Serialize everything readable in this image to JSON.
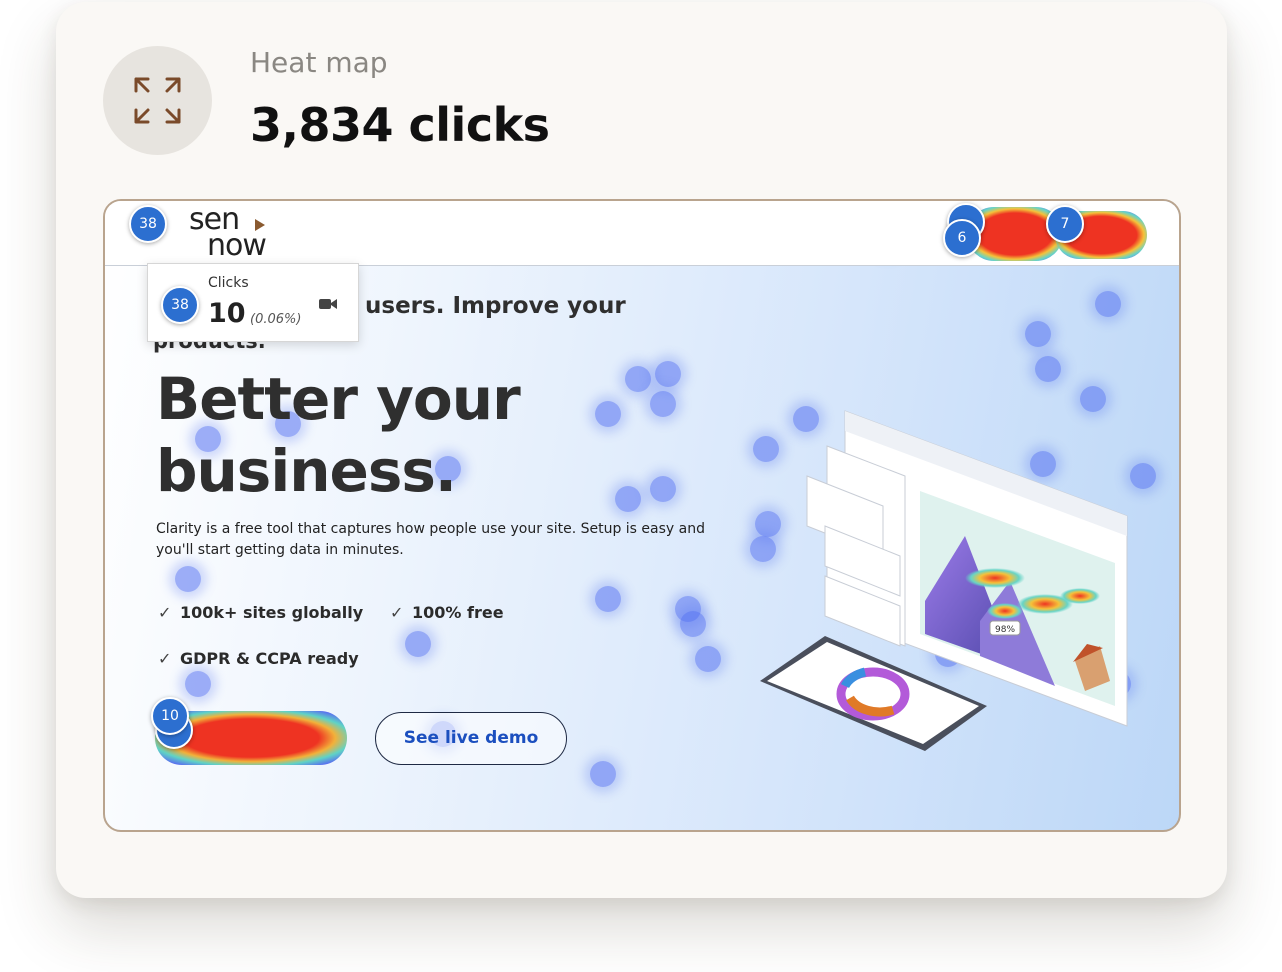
{
  "header": {
    "label": "Heat map",
    "count": "3,834 clicks",
    "expand_icon": "expand-arrows-icon"
  },
  "site": {
    "logo_line1": "sen",
    "logo_line2": "now",
    "tagline_start": "products.",
    "tagline_end": "users. Improve your",
    "headline_line1": "Better your",
    "headline_line2": "business.",
    "description": "Clarity is a free tool that captures how people use your site. Setup is easy and you'll start getting data in minutes.",
    "features": [
      "100k+ sites globally",
      "100% free",
      "GDPR & CCPA ready"
    ],
    "demo_button": "See live demo"
  },
  "tooltip": {
    "badge": "38",
    "label": "Clicks",
    "value": "10",
    "percent": "(0.06%)",
    "icon": "video-camera-icon"
  },
  "markers": {
    "logo": "38",
    "nav_a_back": "",
    "nav_a": "6",
    "nav_b": "7",
    "cta": "10"
  },
  "illustration": {
    "percent_label": "98%"
  },
  "colors": {
    "hot": "#ee3322",
    "marker": "#2c6fd0",
    "frame_border": "#b9a48e",
    "card_bg": "#faf8f5"
  }
}
